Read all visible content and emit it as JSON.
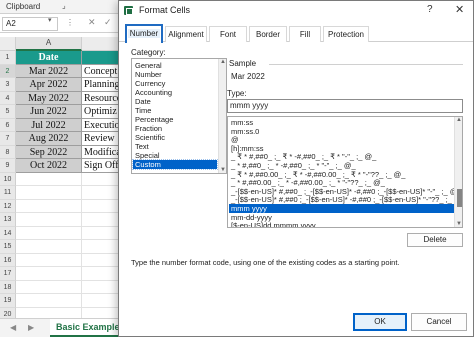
{
  "excel": {
    "ribbon_group": "Clipboard",
    "launcher_icon": "dialog-launcher-icon",
    "name_box": "A2",
    "formula_dots": "⋮",
    "formula_cancel": "✕",
    "formula_enter": "✓",
    "column_header": "A",
    "header_row": {
      "row": "1",
      "a": "Date",
      "b": ""
    },
    "rows": [
      {
        "row": "2",
        "a": "Mar 2022",
        "b": "Concept"
      },
      {
        "row": "3",
        "a": "Apr 2022",
        "b": "Planning"
      },
      {
        "row": "4",
        "a": "May 2022",
        "b": "Resource"
      },
      {
        "row": "5",
        "a": "Jun 2022",
        "b": "Optimiz"
      },
      {
        "row": "6",
        "a": "Jul 2022",
        "b": "Executio"
      },
      {
        "row": "7",
        "a": "Aug 2022",
        "b": "Review"
      },
      {
        "row": "8",
        "a": "Sep 2022",
        "b": "Modifica"
      },
      {
        "row": "9",
        "a": "Oct 2022",
        "b": "Sign Off"
      }
    ],
    "blank_rows": [
      "10",
      "11",
      "12",
      "13",
      "14",
      "15",
      "16",
      "17",
      "18",
      "19",
      "20"
    ],
    "sheet_tab": "Basic Example",
    "tab_prev": "◀",
    "tab_next": "▶",
    "header_color": "#1a9a8c"
  },
  "dialog": {
    "title": "Format Cells",
    "help": "?",
    "close": "✕",
    "tabs": [
      "Number",
      "Alignment",
      "Font",
      "Border",
      "Fill",
      "Protection"
    ],
    "active_tab": "Number",
    "category_label": "Category:",
    "categories": [
      "General",
      "Number",
      "Currency",
      "Accounting",
      "Date",
      "Time",
      "Percentage",
      "Fraction",
      "Scientific",
      "Text",
      "Special",
      "Custom"
    ],
    "selected_category": "Custom",
    "sample_label": "Sample",
    "sample_value": "Mar 2022",
    "type_label": "Type:",
    "type_value": "mmm yyyy",
    "formats": [
      "mm:ss",
      "mm:ss.0",
      "@",
      "[h]:mm:ss",
      "_ ₹ * #,##0_ ;_ ₹ * -#,##0_ ;_ ₹ * \"-\"_ ;_ @_",
      "_ * #,##0_ ;_ * -#,##0_ ;_ * \"-\"_ ;_ @_",
      "_ ₹ * #,##0.00_ ;_ ₹ * -#,##0.00_ ;_ ₹ * \"-\"??_ ;_ @_",
      "_ * #,##0.00_ ;_ * -#,##0.00_ ;_ * \"-\"??_ ;_ @_",
      "_-[$$-en-US]* #,##0_ ;_-[$$-en-US]* -#,##0 ;_-[$$-en-US]* \"-\"_ ;_ @_",
      "_-[$$-en-US]* #,##0 ;_-[$$-en-US]* -#,##0 ;_-[$$-en-US]* \"-\"??_ ;_ @_",
      "mmm yyyy",
      "mm-dd-yyyy",
      "[$-en-US]dd mmmm yyyy"
    ],
    "selected_format": "mmm yyyy",
    "delete_label": "Delete",
    "hint": "Type the number format code, using one of the existing codes as a starting point.",
    "ok_label": "OK",
    "cancel_label": "Cancel",
    "accent_color": "#0062c9"
  }
}
